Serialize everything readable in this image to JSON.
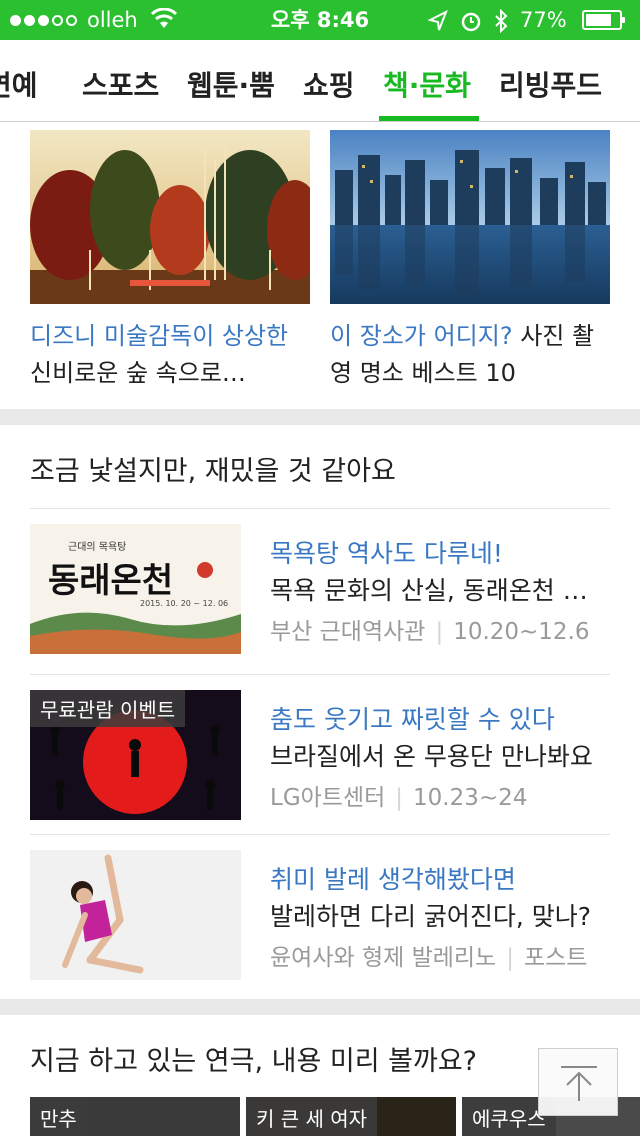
{
  "status": {
    "carrier": "olleh",
    "time": "오후 8:46",
    "battery_pct": "77%",
    "battery_level": 0.77
  },
  "tabs": [
    {
      "label": "연예"
    },
    {
      "label": "스포츠"
    },
    {
      "label": "웹툰·뿜"
    },
    {
      "label": "쇼핑"
    },
    {
      "label": "책·문화",
      "active": true
    },
    {
      "label": "리빙푸드"
    }
  ],
  "featured": [
    {
      "highlight": "디즈니 미술감독이 상상한",
      "rest": " 신비로운 숲 속으로…"
    },
    {
      "highlight": "이 장소가 어디지?",
      "rest": " 사진 촬영 명소 베스트 10"
    }
  ],
  "section1": {
    "title": "조금 낯설지만, 재밌을 것 같아요",
    "items": [
      {
        "headline": "목욕탕 역사도 다루네!",
        "subtitle": "목욕 문화의 산실, 동래온천 …",
        "source": "부산 근대역사관",
        "date": "10.20~12.6",
        "badge": "",
        "thumb_text": "동래온천",
        "thumb_small": "근대의 목욕탕",
        "thumb_dates": "2015. 10. 20 ~ 12. 06"
      },
      {
        "headline": "춤도 웃기고 짜릿할 수 있다",
        "subtitle": "브라질에서 온 무용단 만나봐요",
        "source": "LG아트센터",
        "date": "10.23~24",
        "badge": "무료관람 이벤트"
      },
      {
        "headline": "취미 발레 생각해봤다면",
        "subtitle": "발레하면 다리 굵어진다, 맞나?",
        "source": "윤여사와 형제 발레리노",
        "date": "포스트",
        "badge": ""
      }
    ]
  },
  "section2": {
    "title": "지금 하고 있는 연극, 내용 미리 볼까요?",
    "items": [
      {
        "label": "만추"
      },
      {
        "label": "키 큰 세 여자"
      },
      {
        "label": "에쿠우스"
      }
    ]
  },
  "colors": {
    "status_bar": "#2ac02f",
    "accent_green": "#19b923",
    "link_blue": "#3a78c3"
  }
}
